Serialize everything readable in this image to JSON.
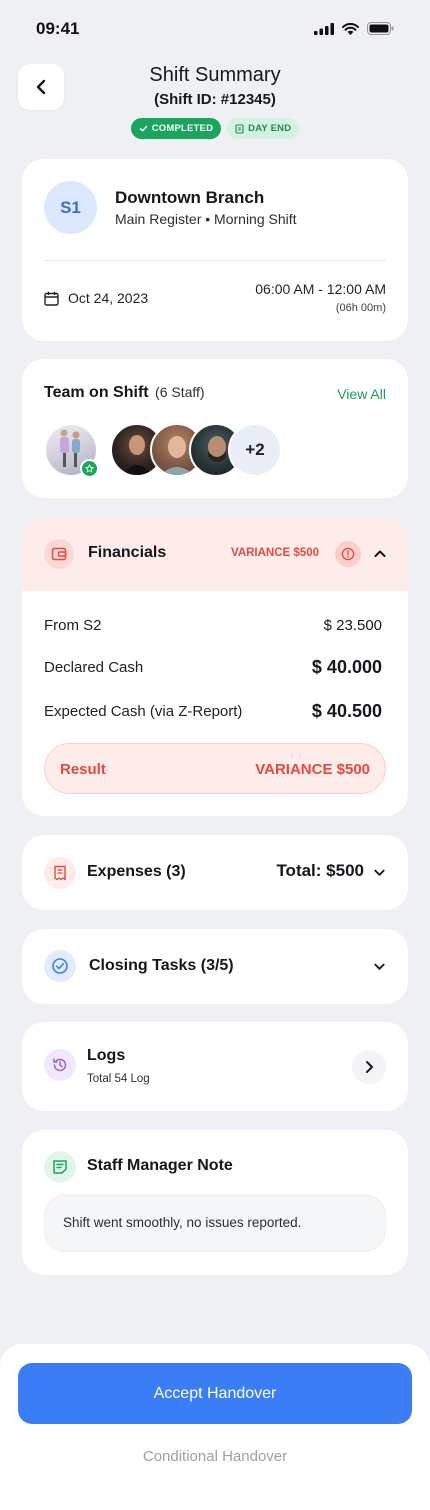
{
  "status_bar": {
    "time": "09:41"
  },
  "header": {
    "title": "Shift Summary",
    "subtitle": "(Shift ID: #12345)",
    "badges": {
      "completed": "COMPLETED",
      "day_end": "DAY END"
    }
  },
  "branch": {
    "initials": "S1",
    "name": "Downtown Branch",
    "meta": "Main Register • Morning Shift",
    "date": "Oct 24, 2023",
    "time_range": "06:00 AM - 12:00 AM",
    "duration": "(06h 00m)"
  },
  "team": {
    "title": "Team on Shift",
    "count": "(6 Staff)",
    "view_all": "View All",
    "more": "+2"
  },
  "financials": {
    "title": "Financials",
    "variance_badge": "VARIANCE $500",
    "rows": [
      {
        "label": "From S2",
        "value": "$ 23.500"
      },
      {
        "label": "Declared Cash",
        "value": "$ 40.000"
      },
      {
        "label": "Expected Cash (via Z-Report)",
        "value": "$ 40.500"
      }
    ],
    "result_label": "Result",
    "result_value": "VARIANCE $500"
  },
  "expenses": {
    "title": "Expenses (3)",
    "total": "Total: $500"
  },
  "closing_tasks": {
    "title": "Closing Tasks (3/5)"
  },
  "logs": {
    "title": "Logs",
    "subtitle": "Total 54 Log"
  },
  "note": {
    "title": "Staff Manager Note",
    "text": "Shift went smoothly, no issues reported."
  },
  "actions": {
    "accept": "Accept Handover",
    "conditional": "Conditional Handover"
  },
  "colors": {
    "accent_blue": "#3b7df5",
    "success_green": "#1aa55c",
    "danger_red": "#e14a43",
    "background": "#eef0f3"
  }
}
